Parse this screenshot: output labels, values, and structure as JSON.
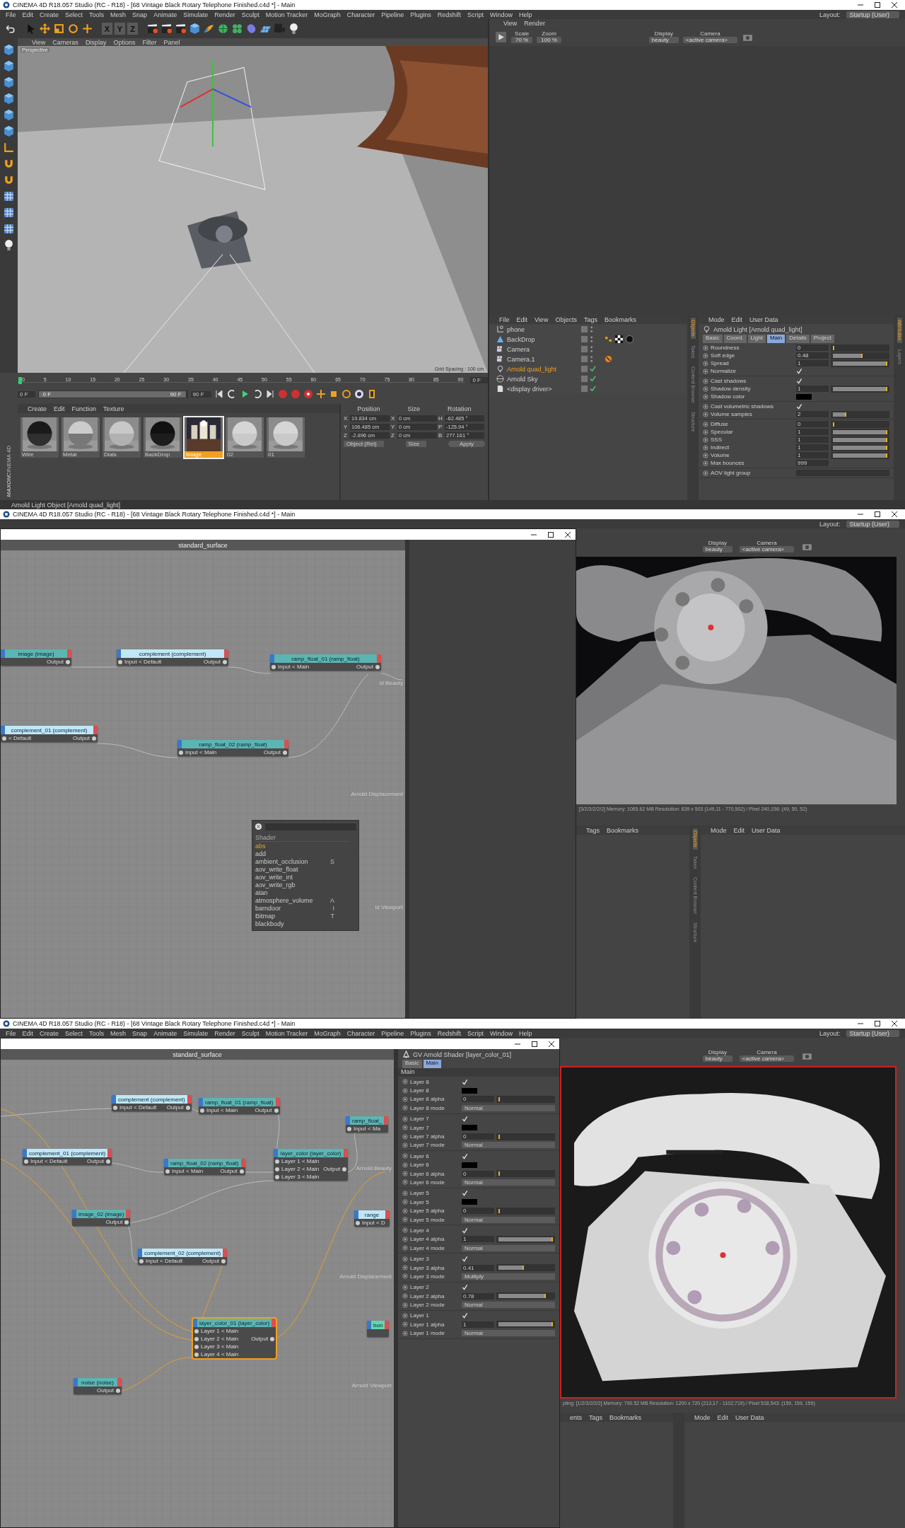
{
  "top_window": {
    "title": "CINEMA 4D R18.057 Studio (RC - R18) - [68 Vintage Black Rotary Telephone Finished.c4d *] - Main",
    "menu": [
      "File",
      "Edit",
      "Create",
      "Select",
      "Tools",
      "Mesh",
      "Snap",
      "Animate",
      "Simulate",
      "Render",
      "Sculpt",
      "Motion Tracker",
      "MoGraph",
      "Character",
      "Pipeline",
      "Plugins",
      "Redshift",
      "Script",
      "Window",
      "Help"
    ],
    "layout_label": "Layout:",
    "layout_value": "Startup (User)",
    "axis_keys": [
      "X",
      "Y",
      "Z"
    ],
    "render_menu": [
      "View",
      "Render"
    ],
    "scale_label": "Scale",
    "scale_value": "70 %",
    "zoom_label": "Zoom",
    "zoom_value": "100 %",
    "display_label": "Display",
    "display_value": "beauty",
    "camera_label": "Camera",
    "camera_value": "<active camera>",
    "viewport": {
      "menu": [
        "View",
        "Cameras",
        "Display",
        "Options",
        "Filter",
        "Panel"
      ],
      "view_name": "Perspective",
      "grid_note": "Grid Spacing : 100 cm"
    },
    "timeline": {
      "ticks": [
        "0",
        "5",
        "10",
        "15",
        "20",
        "25",
        "30",
        "35",
        "40",
        "45",
        "50",
        "55",
        "60",
        "65",
        "70",
        "75",
        "80",
        "85",
        "90"
      ],
      "current_frame": "0 F",
      "start_field": "0 F",
      "range": {
        "start": "0 F",
        "end": "90 F",
        "level": 1
      },
      "end_field": "90 F"
    },
    "materials": {
      "menu": [
        "Create",
        "Edit",
        "Function",
        "Texture"
      ],
      "items": [
        {
          "name": "Wire",
          "kind": "dark",
          "selected": false
        },
        {
          "name": "Metal",
          "kind": "chrome",
          "selected": false
        },
        {
          "name": "Dials",
          "kind": "marble",
          "selected": false
        },
        {
          "name": "BackDrop",
          "kind": "black",
          "selected": false
        },
        {
          "name": "Image",
          "selected": true
        },
        {
          "name": "02",
          "kind": "white",
          "selected": false
        },
        {
          "name": "01",
          "kind": "white",
          "selected": false
        }
      ]
    },
    "brand": [
      "MAXON",
      "CINEMA 4D"
    ],
    "coordinates": {
      "headers": [
        "Position",
        "Size",
        "Rotation"
      ],
      "rows": [
        {
          "axis": "X",
          "position": "19.834 cm",
          "size_axis": "X",
          "size": "0 cm",
          "rotation_axis": "H",
          "rotation": "-62.485 °"
        },
        {
          "axis": "Y",
          "position": "106.485 cm",
          "size_axis": "Y",
          "size": "0 cm",
          "rotation_axis": "P",
          "rotation": "-125.94 °"
        },
        {
          "axis": "Z",
          "position": "-2.896 cm",
          "size_axis": "Z",
          "size": "0 cm",
          "rotation_axis": "B",
          "rotation": "277.161 °"
        }
      ],
      "mode": "Object (Rel)",
      "size_mode": "Size",
      "apply": "Apply"
    },
    "objects": {
      "menu": [
        "File",
        "Edit",
        "View",
        "Objects",
        "Tags",
        "Bookmarks"
      ],
      "items": [
        {
          "name": "phone",
          "kind": "null",
          "enabled": false,
          "selected": false
        },
        {
          "name": "BackDrop",
          "kind": "backdrop",
          "enabled": false,
          "selected": false
        },
        {
          "name": "Camera",
          "kind": "camera",
          "enabled": false,
          "selected": false
        },
        {
          "name": "Camera.1",
          "kind": "camera",
          "enabled": false,
          "selected": false
        },
        {
          "name": "Arnold quad_light",
          "kind": "light",
          "enabled": true,
          "selected": true
        },
        {
          "name": "Arnold Sky",
          "kind": "sky",
          "enabled": true,
          "selected": false
        },
        {
          "name": "<display driver>",
          "kind": "driver",
          "enabled": true,
          "selected": false
        }
      ]
    },
    "side_tabs": [
      {
        "label": "Objects",
        "selected": true
      },
      {
        "label": "Takes",
        "selected": false
      },
      {
        "label": "Content Browser",
        "selected": false
      },
      {
        "label": "Structure",
        "selected": false
      }
    ],
    "attributes": {
      "menu": [
        "Mode",
        "Edit",
        "User Data"
      ],
      "title": "Arnold Light [Arnold quad_light]",
      "tabs": [
        {
          "label": "Basic",
          "selected": false
        },
        {
          "label": "Coord.",
          "selected": false
        },
        {
          "label": "Light",
          "selected": false
        },
        {
          "label": "Main",
          "selected": true
        },
        {
          "label": "Details",
          "selected": false
        },
        {
          "label": "Project",
          "selected": false
        }
      ],
      "groups": [
        [
          {
            "kind": "slider",
            "label": "Roundness",
            "value": "0",
            "level": 0
          },
          {
            "kind": "slider",
            "label": "Soft edge",
            "value": "0.48",
            "level": 0.48
          },
          {
            "kind": "slider",
            "label": "Spread",
            "value": "1",
            "level": 1
          },
          {
            "kind": "check",
            "label": "Normalize",
            "checked": true
          }
        ],
        [
          {
            "kind": "check",
            "label": "Cast shadows",
            "checked": true
          },
          {
            "kind": "slider",
            "label": "Shadow density",
            "value": "1",
            "level": 1
          },
          {
            "kind": "color",
            "label": "Shadow color",
            "color": "#000000"
          }
        ],
        [
          {
            "kind": "check",
            "label": "Cast volumetric shadows",
            "checked": true
          },
          {
            "kind": "slider",
            "label": "Volume samples",
            "value": "2",
            "level": 0.2
          }
        ],
        [
          {
            "kind": "slider",
            "label": "Diffuse",
            "value": "0",
            "level": 0
          },
          {
            "kind": "slider",
            "label": "Specular",
            "value": "1",
            "level": 1
          },
          {
            "kind": "slider",
            "label": "SSS",
            "value": "1",
            "level": 1
          },
          {
            "kind": "slider",
            "label": "Indirect",
            "value": "1",
            "level": 1
          },
          {
            "kind": "slider",
            "label": "Volume",
            "value": "1",
            "level": 1
          },
          {
            "kind": "field",
            "label": "Max bounces",
            "value": "999"
          }
        ],
        [
          {
            "kind": "field",
            "label": "AOV light group"
          }
        ]
      ]
    },
    "right_tabs": [
      {
        "label": "Attributes",
        "selected": true
      },
      {
        "label": "Layers",
        "selected": false
      }
    ],
    "status": "Arnold Light Object [Arnold quad_light]"
  },
  "middle_window": {
    "title": "CINEMA 4D R18.057 Studio (RC - R18) - [68 Vintage Black Rotary Telephone Finished.c4d *] - Main",
    "layout_label": "Layout:",
    "layout_value": "Startup (User)",
    "node_editor": {
      "header": "standard_surface",
      "nodes": [
        {
          "title": "image (image)",
          "color": "#5bb5b2",
          "rows": [
            {
              "right": "Output"
            }
          ]
        },
        {
          "title": "complement (complement)",
          "color": "#bfe7f7",
          "rows": [
            {
              "left": "Input < Default",
              "right": "Output"
            }
          ]
        },
        {
          "title": "ramp_float_01 (ramp_float)",
          "color": "#5bb5b2",
          "rows": [
            {
              "left": "Input < Main",
              "right": "Output"
            }
          ]
        },
        {
          "title": "complement_01 (complement)",
          "color": "#bfe7f7",
          "rows": [
            {
              "left": "< Default",
              "right": "Output"
            }
          ]
        },
        {
          "title": "ramp_float_02 (ramp_float)",
          "color": "#5bb5b2",
          "rows": [
            {
              "left": "Input < Main",
              "right": "Output"
            }
          ]
        }
      ],
      "ports": [
        "ld Beauty",
        "Arnold Displacement",
        "ld Viewport"
      ],
      "shader_list": {
        "header": "Shader",
        "items": [
          {
            "name": "abs",
            "selected": true
          },
          {
            "name": "add",
            "selected": false
          },
          {
            "name": "ambient_occlusion",
            "shortcut": "S",
            "selected": false
          },
          {
            "name": "aov_write_float",
            "selected": false
          },
          {
            "name": "aov_write_int",
            "selected": false
          },
          {
            "name": "aov_write_rgb",
            "selected": false
          },
          {
            "name": "atan",
            "selected": false
          },
          {
            "name": "atmosphere_volume",
            "shortcut": "A",
            "selected": false
          },
          {
            "name": "barndoor",
            "shortcut": "I",
            "selected": false
          },
          {
            "name": "Bitmap",
            "shortcut": "T",
            "selected": false
          },
          {
            "name": "blackbody",
            "selected": false
          }
        ]
      }
    },
    "display_label": "Display",
    "display_value": "beauty",
    "camera_label": "Camera",
    "camera_value": "<active camera>",
    "render_info": "[3/2/3/2/2/2]  Memory: 1065.62 MB  Resolution: 839 x 503 (149,11 - 770,502) / Pixel 240,156: (49, 50, 52)",
    "objects_menu": [
      "Tags",
      "Bookmarks"
    ],
    "side_tabs": [
      {
        "label": "Objects",
        "selected": true
      },
      {
        "label": "Takes",
        "selected": false
      },
      {
        "label": "Content Browser",
        "selected": false
      },
      {
        "label": "Structure",
        "selected": false
      }
    ],
    "attributes_menu": [
      "Mode",
      "Edit",
      "User Data"
    ]
  },
  "bottom_window": {
    "title": "CINEMA 4D R18.057 Studio (RC - R18) - [68 Vintage Black Rotary Telephone Finished.c4d *] - Main",
    "menu": [
      "File",
      "Edit",
      "Create",
      "Select",
      "Tools",
      "Mesh",
      "Snap",
      "Animate",
      "Simulate",
      "Render",
      "Sculpt",
      "Motion Tracker",
      "MoGraph",
      "Character",
      "Pipeline",
      "Plugins",
      "Redshift",
      "Script",
      "Window",
      "Help"
    ],
    "layout_label": "Layout:",
    "layout_value": "Startup (User)",
    "node_editor": {
      "header": "standard_surface",
      "nodes": [
        {
          "title": "complement (complement)",
          "color": "#bfe7f7",
          "selected": false,
          "rows": [
            {
              "left": "Input < Default",
              "right": "Output"
            }
          ]
        },
        {
          "title": "ramp_float_01 (ramp_float)",
          "color": "#5bb5b2",
          "selected": false,
          "rows": [
            {
              "left": "Input < Main",
              "right": "Output"
            }
          ]
        },
        {
          "title": "complement_01 (complement)",
          "color": "#bfe7f7",
          "selected": false,
          "rows": [
            {
              "left": "Input < Default",
              "right": "Output"
            }
          ]
        },
        {
          "title": "ramp_float_02 (ramp_float)",
          "color": "#5bb5b2",
          "selected": false,
          "rows": [
            {
              "left": "Input < Main",
              "right": "Output"
            }
          ]
        },
        {
          "title": "layer_color (layer_color)",
          "color": "#5bb5b2",
          "selected": false,
          "rows": [
            {
              "left": "Layer 1 < Main"
            },
            {
              "left": "Layer 2 < Main",
              "right": "Output"
            },
            {
              "left": "Layer 3 < Main"
            }
          ]
        },
        {
          "title": "ramp_float_",
          "color": "#5bb5b2",
          "selected": false,
          "rows": [
            {
              "left": "Input < Ma"
            }
          ]
        },
        {
          "title": "image_02 (image)",
          "color": "#5bb5b2",
          "selected": false,
          "rows": [
            {
              "right": "Output"
            }
          ]
        },
        {
          "title": "range",
          "color": "#bfe7f7",
          "selected": false,
          "rows": [
            {
              "left": "Input < D"
            }
          ]
        },
        {
          "title": "complement_02 (complement)",
          "color": "#bfe7f7",
          "selected": false,
          "rows": [
            {
              "left": "Input < Default",
              "right": "Output"
            }
          ]
        },
        {
          "title": "bun",
          "color": "#5fd8b0",
          "selected": false
        },
        {
          "title": "layer_color_01 (layer_color)",
          "color": "#5bb5b2",
          "selected": true,
          "rows": [
            {
              "left": "Layer 1 < Main"
            },
            {
              "left": "Layer 2 < Main",
              "right": "Output"
            },
            {
              "left": "Layer 3 < Main"
            },
            {
              "left": "Layer 4 < Main"
            }
          ]
        },
        {
          "title": "noise (noise)",
          "color": "#5bb5b2",
          "selected": false,
          "rows": [
            {
              "right": "Output"
            }
          ]
        }
      ],
      "ports": [
        "Arnold Beauty",
        "Arnold Displacement",
        "Arnold Viewport"
      ]
    },
    "attributes": {
      "title": "GV Arnold Shader [layer_color_01]",
      "tabs": [
        {
          "label": "Basic",
          "selected": false
        },
        {
          "label": "Main",
          "selected": true
        }
      ],
      "section": "Main",
      "groups": [
        [
          {
            "kind": "check",
            "label": "Layer 8",
            "checked": true
          },
          {
            "kind": "color",
            "label": "Layer 8",
            "color": "#000000"
          },
          {
            "kind": "slider",
            "label": "Layer 8 alpha",
            "value": "0",
            "level": 0
          },
          {
            "kind": "select",
            "label": "Layer 8 mode",
            "value": "Normal"
          }
        ],
        [
          {
            "kind": "check",
            "label": "Layer 7",
            "checked": true
          },
          {
            "kind": "color",
            "label": "Layer 7",
            "color": "#000000"
          },
          {
            "kind": "slider",
            "label": "Layer 7 alpha",
            "value": "0",
            "level": 0
          },
          {
            "kind": "select",
            "label": "Layer 7 mode",
            "value": "Normal"
          }
        ],
        [
          {
            "kind": "check",
            "label": "Layer 6",
            "checked": true
          },
          {
            "kind": "color",
            "label": "Layer 6",
            "color": "#000000"
          },
          {
            "kind": "slider",
            "label": "Layer 6 alpha",
            "value": "0",
            "level": 0
          },
          {
            "kind": "select",
            "label": "Layer 6 mode",
            "value": "Normal"
          }
        ],
        [
          {
            "kind": "check",
            "label": "Layer 5",
            "checked": true
          },
          {
            "kind": "color",
            "label": "Layer 5",
            "color": "#000000"
          },
          {
            "kind": "slider",
            "label": "Layer 5 alpha",
            "value": "0",
            "level": 0
          },
          {
            "kind": "select",
            "label": "Layer 5 mode",
            "value": "Normal"
          }
        ],
        [
          {
            "kind": "check",
            "label": "Layer 4",
            "checked": true
          },
          {
            "kind": "slider",
            "label": "Layer 4 alpha",
            "value": "1",
            "level": 1
          },
          {
            "kind": "select",
            "label": "Layer 4 mode",
            "value": "Normal"
          }
        ],
        [
          {
            "kind": "check",
            "label": "Layer 3",
            "checked": true
          },
          {
            "kind": "slider",
            "label": "Layer 3 alpha",
            "value": "0.41",
            "level": 0.41
          },
          {
            "kind": "select",
            "label": "Layer 3 mode",
            "value": "Multiply"
          }
        ],
        [
          {
            "kind": "check",
            "label": "Layer 2",
            "checked": true
          },
          {
            "kind": "slider",
            "label": "Layer 2 alpha",
            "value": "0.78",
            "level": 0.78
          },
          {
            "kind": "select",
            "label": "Layer 2 mode",
            "value": "Normal"
          }
        ],
        [
          {
            "kind": "check",
            "label": "Layer 1",
            "checked": true
          },
          {
            "kind": "slider",
            "label": "Layer 1 alpha",
            "value": "1",
            "level": 1
          },
          {
            "kind": "select",
            "label": "Layer 1 mode",
            "value": "Normal"
          }
        ]
      ]
    },
    "display_label": "Display",
    "display_value": "beauty",
    "camera_label": "Camera",
    "camera_value": "<active camera>",
    "render_info": "pling: [1/2/3/2/2/2]  Memory: 790.52 MB  Resolution: 1200 x 720 (213,17 - 1102,719) / Pixel 518,543: (159, 159, 159)",
    "objects_menu": [
      "ents",
      "Tags",
      "Bookmarks"
    ],
    "attributes_menu": [
      "Mode",
      "Edit",
      "User Data"
    ]
  }
}
